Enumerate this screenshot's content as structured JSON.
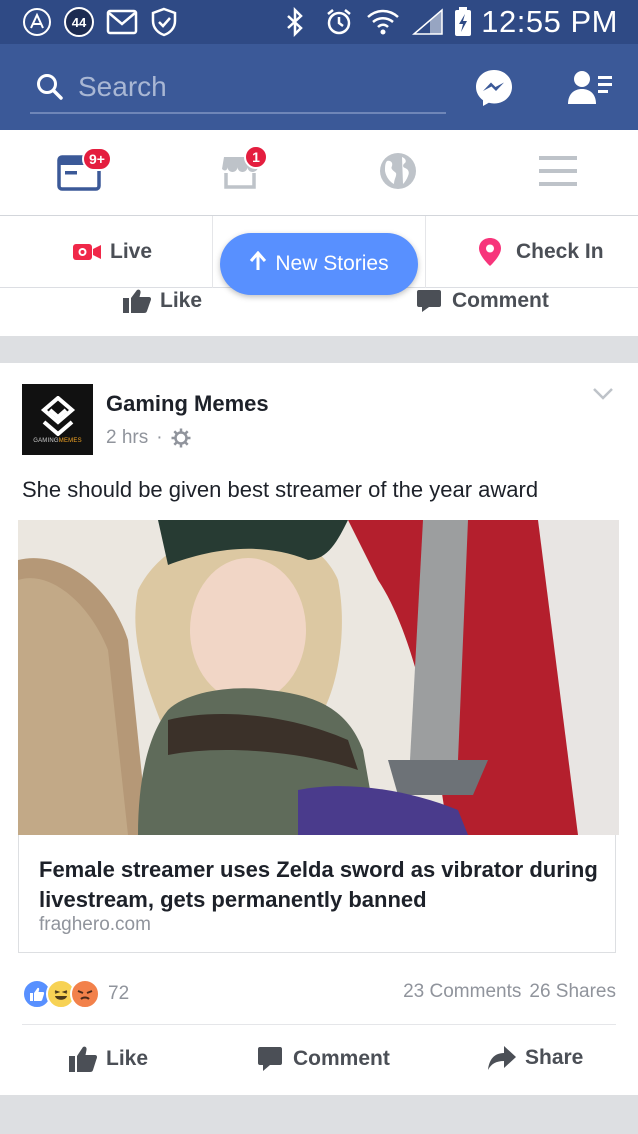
{
  "status_bar": {
    "notification_count": "44",
    "time": "12:55 PM"
  },
  "header": {
    "search_placeholder": "Search",
    "icons": [
      "search-icon",
      "messenger-icon",
      "friend-requests-icon"
    ]
  },
  "nav": {
    "news_feed_badge": "9+",
    "marketplace_badge": "1",
    "tabs": [
      "news-feed",
      "marketplace",
      "notifications-globe",
      "menu"
    ]
  },
  "composer": {
    "live_label": "Live",
    "checkin_label": "Check In"
  },
  "new_stories_label": "New Stories",
  "prior_post": {
    "like_label": "Like",
    "comment_label": "Comment"
  },
  "post": {
    "page_name": "Gaming Memes",
    "time": "2 hrs",
    "separator": "·",
    "text": "She should be given best streamer of the year award",
    "avatar_text_a": "GAMING",
    "avatar_text_b": "MEMES",
    "link_title": "Female streamer uses Zelda sword as vibrator during livestream, gets permanently banned",
    "link_domain": "fraghero.com",
    "reaction_count": "72",
    "comments": "23 Comments",
    "shares": "26 Shares",
    "like_label": "Like",
    "comment_label": "Comment",
    "share_label": "Share"
  },
  "colors": {
    "status_bar": "#2f4a85",
    "header": "#3b5998",
    "new_stories": "#5890ff",
    "badge": "#e41e3f",
    "text": "#1d2129",
    "muted": "#90949c"
  }
}
